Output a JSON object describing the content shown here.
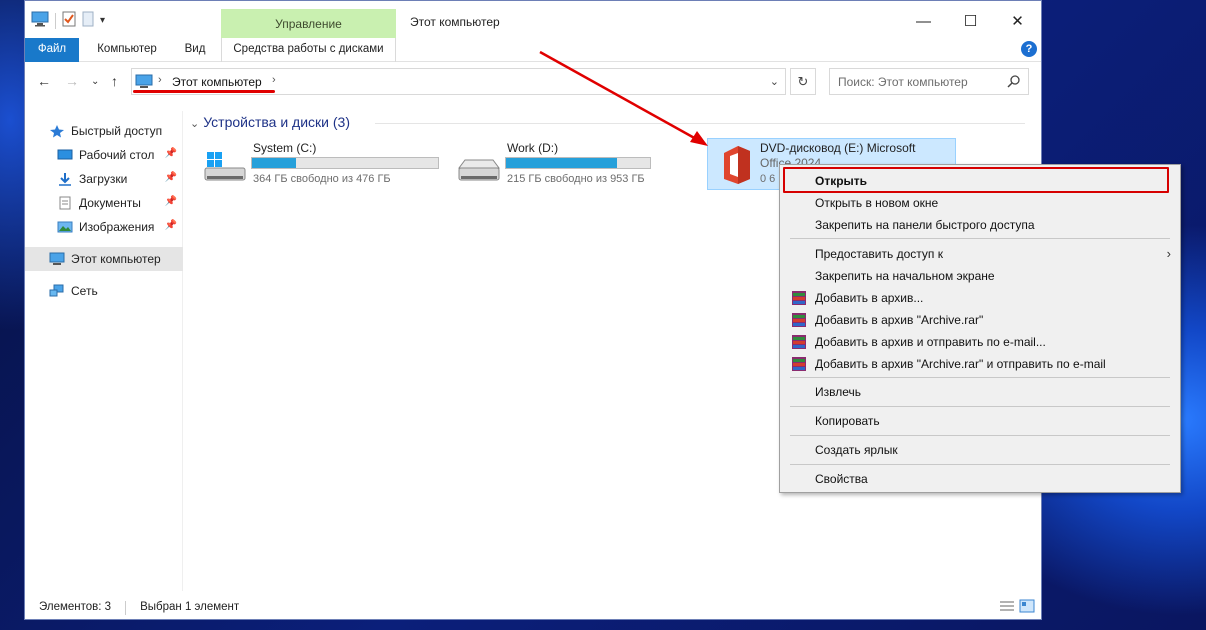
{
  "window": {
    "title": "Этот компьютер",
    "context_tab_header": "Управление",
    "tabs": [
      {
        "label": "Файл"
      },
      {
        "label": "Компьютер"
      },
      {
        "label": "Вид"
      },
      {
        "label": "Средства работы с дисками"
      }
    ],
    "controls": {
      "minimize": "—",
      "maximize": "☐",
      "close": "✕"
    }
  },
  "address": {
    "crumb": "Этот компьютер",
    "search_placeholder": "Поиск: Этот компьютер"
  },
  "sidebar": {
    "items": [
      {
        "label": "Быстрый доступ"
      },
      {
        "label": "Рабочий стол"
      },
      {
        "label": "Загрузки"
      },
      {
        "label": "Документы"
      },
      {
        "label": "Изображения"
      },
      {
        "label": "Этот компьютер"
      },
      {
        "label": "Сеть"
      }
    ]
  },
  "content": {
    "group_title": "Устройства и диски (3)",
    "drives": [
      {
        "name": "System (C:)",
        "free": "364 ГБ свободно из 476 ГБ",
        "used_fraction": 0.235
      },
      {
        "name": "Work (D:)",
        "free": "215 ГБ свободно из 953 ГБ",
        "used_fraction": 0.774
      },
      {
        "name_line1": "DVD-дисковод (E:) Microsoft",
        "name_line2": "Office 2024",
        "free": "0 6"
      }
    ]
  },
  "context_menu": {
    "items": [
      {
        "label": "Открыть"
      },
      {
        "label": "Открыть в новом окне"
      },
      {
        "label": "Закрепить на панели быстрого доступа"
      },
      {
        "label": "Предоставить доступ к"
      },
      {
        "label": "Закрепить на начальном экране"
      },
      {
        "label": "Добавить в архив..."
      },
      {
        "label": "Добавить в архив \"Archive.rar\""
      },
      {
        "label": "Добавить в архив и отправить по e-mail..."
      },
      {
        "label": "Добавить в архив \"Archive.rar\" и отправить по e-mail"
      },
      {
        "label": "Извлечь"
      },
      {
        "label": "Копировать"
      },
      {
        "label": "Создать ярлык"
      },
      {
        "label": "Свойства"
      }
    ]
  },
  "status": {
    "items_count": "Элементов: 3",
    "selected": "Выбран 1 элемент"
  },
  "colors": {
    "accent": "#1979ca",
    "context_tab": "#c9f0b0",
    "annotation_red": "#e00000",
    "selection": "#cce8ff"
  }
}
